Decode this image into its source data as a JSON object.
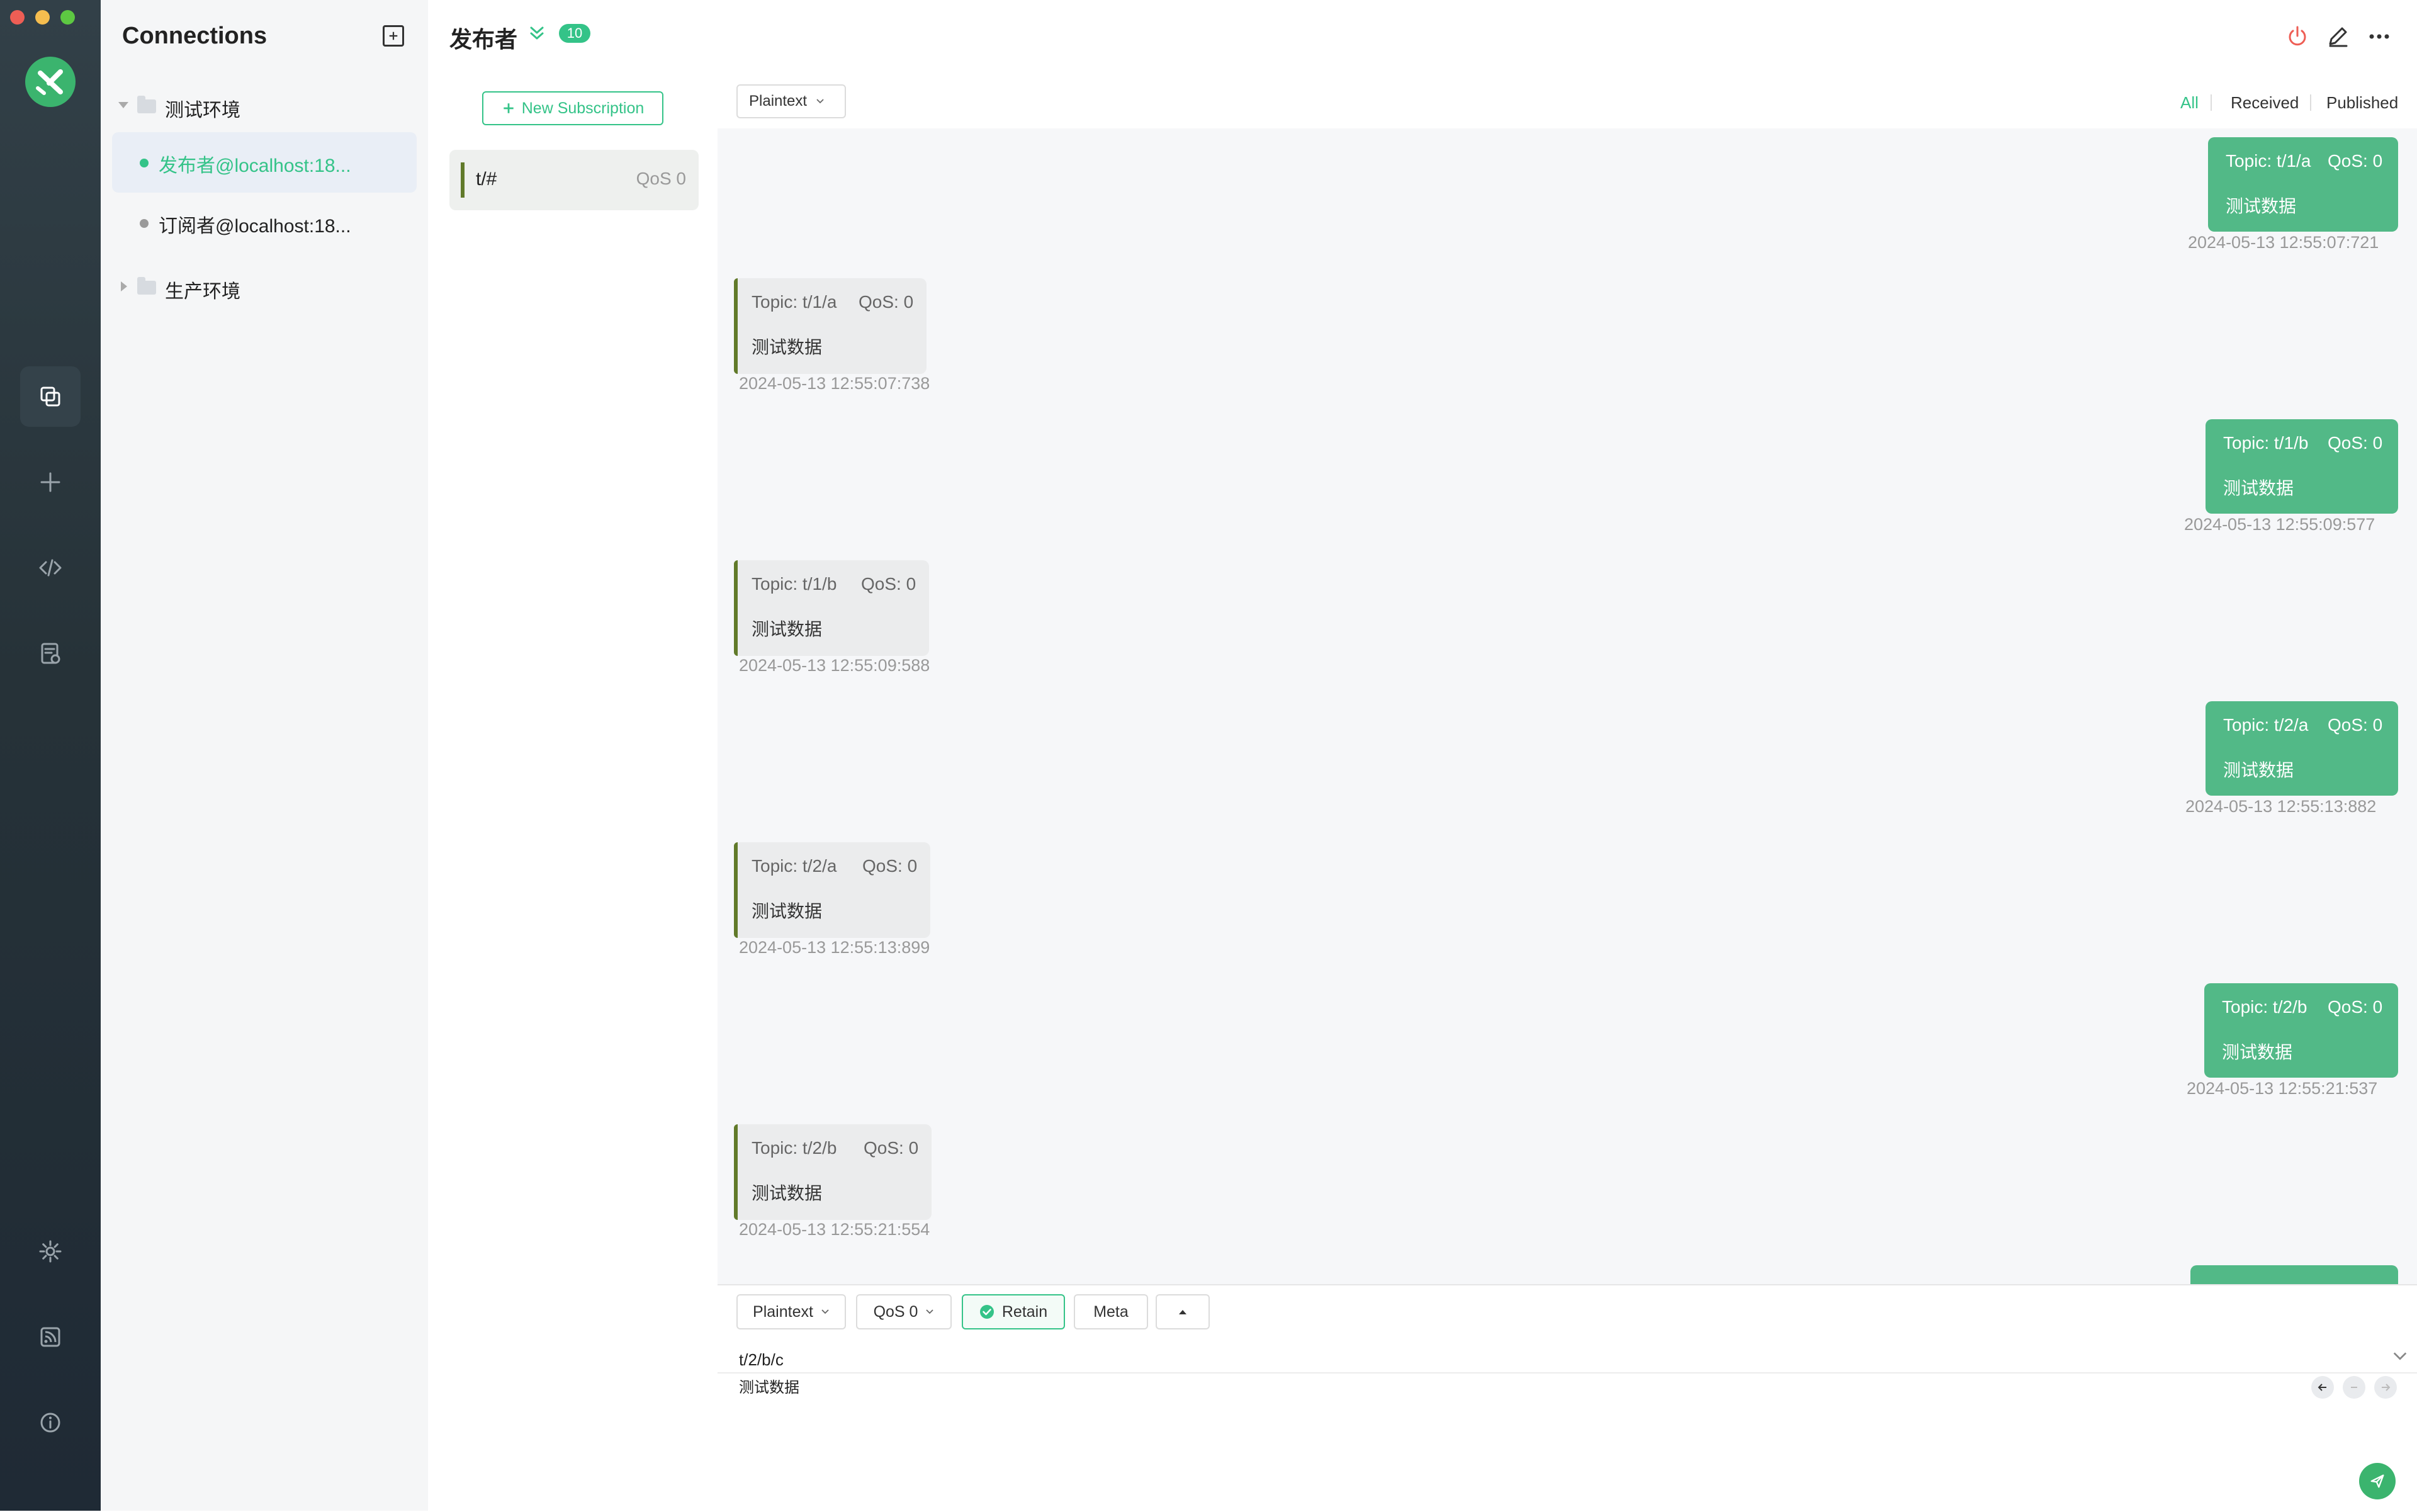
{
  "sidebar_left": {
    "items": [
      {
        "name": "connections-nav",
        "icon": "copy-icon",
        "active": true
      },
      {
        "name": "new-connection-nav",
        "icon": "plus-icon",
        "active": false
      },
      {
        "name": "script-nav",
        "icon": "code-icon",
        "active": false
      },
      {
        "name": "log-nav",
        "icon": "log-icon",
        "active": false
      },
      {
        "name": "settings-nav",
        "icon": "gear-icon",
        "active": false
      },
      {
        "name": "feed-nav",
        "icon": "rss-icon",
        "active": false
      },
      {
        "name": "about-nav",
        "icon": "info-icon",
        "active": false
      }
    ]
  },
  "connections": {
    "title": "Connections",
    "groups": [
      {
        "label": "测试环境",
        "expanded": true,
        "items": [
          {
            "label": "发布者@localhost:18...",
            "status_color": "#34c388",
            "active": true
          },
          {
            "label": "订阅者@localhost:18...",
            "status_color": "#9a9a9a",
            "active": false
          }
        ]
      },
      {
        "label": "生产环境",
        "expanded": false,
        "items": []
      }
    ]
  },
  "header": {
    "connection_name": "发布者",
    "unread_badge": "10"
  },
  "subscriptions": {
    "new_button": "New Subscription",
    "items": [
      {
        "topic": "t/#",
        "qos": "QoS 0",
        "color": "#617a2a"
      }
    ]
  },
  "message_toolbar": {
    "format": "Plaintext",
    "filters": [
      "All",
      "Received",
      "Published"
    ],
    "active_filter": "All"
  },
  "messages": [
    {
      "direction": "out",
      "topic": "Topic: t/1/a",
      "qos": "QoS: 0",
      "payload": "测试数据",
      "time": "2024-05-13 12:55:07:721"
    },
    {
      "direction": "in",
      "topic": "Topic: t/1/a",
      "qos": "QoS: 0",
      "payload": "测试数据",
      "time": "2024-05-13 12:55:07:738"
    },
    {
      "direction": "out",
      "topic": "Topic: t/1/b",
      "qos": "QoS: 0",
      "payload": "测试数据",
      "time": "2024-05-13 12:55:09:577"
    },
    {
      "direction": "in",
      "topic": "Topic: t/1/b",
      "qos": "QoS: 0",
      "payload": "测试数据",
      "time": "2024-05-13 12:55:09:588"
    },
    {
      "direction": "out",
      "topic": "Topic: t/2/a",
      "qos": "QoS: 0",
      "payload": "测试数据",
      "time": "2024-05-13 12:55:13:882"
    },
    {
      "direction": "in",
      "topic": "Topic: t/2/a",
      "qos": "QoS: 0",
      "payload": "测试数据",
      "time": "2024-05-13 12:55:13:899"
    },
    {
      "direction": "out",
      "topic": "Topic: t/2/b",
      "qos": "QoS: 0",
      "payload": "测试数据",
      "time": "2024-05-13 12:55:21:537"
    },
    {
      "direction": "in",
      "topic": "Topic: t/2/b",
      "qos": "QoS: 0",
      "payload": "测试数据",
      "time": "2024-05-13 12:55:21:554"
    }
  ],
  "composer": {
    "format": "Plaintext",
    "qos": "QoS 0",
    "retain_label": "Retain",
    "retain_checked": true,
    "meta_label": "Meta",
    "topic": "t/2/b/c",
    "payload": "测试数据"
  },
  "colors": {
    "accent": "#34c388",
    "published_bubble": "#52b987",
    "received_bubble": "#ebeced",
    "subscription_color": "#617a2a",
    "rail": "#263238"
  }
}
